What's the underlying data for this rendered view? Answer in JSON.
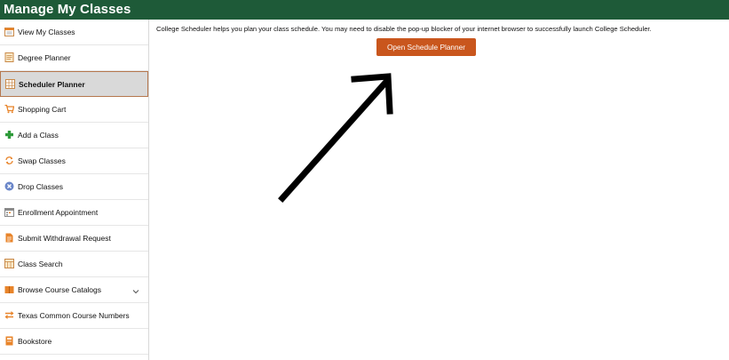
{
  "header": {
    "title": "Manage My Classes"
  },
  "sidebar": {
    "items": [
      {
        "label": "View My Classes",
        "icon": "calendar-list-icon"
      },
      {
        "label": "Degree Planner",
        "icon": "notepad-icon"
      },
      {
        "label": "Scheduler Planner",
        "icon": "calendar-grid-icon",
        "selected": true
      },
      {
        "label": "Shopping Cart",
        "icon": "shopping-cart-icon"
      },
      {
        "label": "Add a Class",
        "icon": "plus-icon"
      },
      {
        "label": "Swap Classes",
        "icon": "swap-icon"
      },
      {
        "label": "Drop Classes",
        "icon": "drop-x-icon"
      },
      {
        "label": "Enrollment Appointment",
        "icon": "appointment-calendar-icon"
      },
      {
        "label": "Submit Withdrawal Request",
        "icon": "document-icon"
      },
      {
        "label": "Class Search",
        "icon": "class-search-icon"
      },
      {
        "label": "Browse Course Catalogs",
        "icon": "catalog-book-icon",
        "expandable": true
      },
      {
        "label": "Texas Common Course Numbers",
        "icon": "exchange-arrows-icon"
      },
      {
        "label": "Bookstore",
        "icon": "bookstore-icon"
      }
    ]
  },
  "main": {
    "description": "College Scheduler helps you plan your class schedule. You may need to disable the pop-up blocker of your internet browser to successfully launch College Scheduler.",
    "open_button_label": "Open Schedule Planner"
  },
  "colors": {
    "header_bg": "#1e5a38",
    "button_bg": "#c9561d",
    "selected_border": "#b5774e",
    "icon_orange": "#e8842a",
    "icon_green": "#2e9a3a",
    "icon_blue": "#6a86c9"
  }
}
